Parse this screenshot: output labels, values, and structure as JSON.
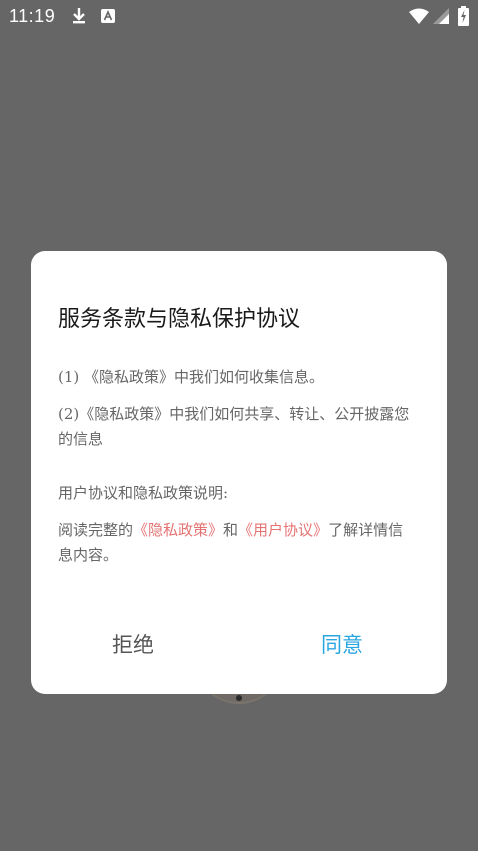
{
  "status_bar": {
    "time": "11:19",
    "icons": [
      "download-icon",
      "keyboard-a-icon",
      "wifi-icon",
      "signal-icon",
      "battery-charging-icon"
    ]
  },
  "dialog": {
    "title": "服务条款与隐私保护协议",
    "item1": "(1) 《隐私政策》中我们如何收集信息。",
    "item2": "(2)《隐私政策》中我们如何共享、转让、公开披露您的信息",
    "explain_label": "用户协议和隐私政策说明:",
    "read_prefix": "阅读完整的",
    "privacy_link": "《隐私政策》",
    "and": "和",
    "user_agreement_link": "《用户协议》",
    "read_suffix": "了解详情信息内容。",
    "refuse_label": "拒绝",
    "agree_label": "同意"
  },
  "colors": {
    "overlay": "#666666",
    "link": "#e57373",
    "agree": "#2aa6e0",
    "text": "#666666",
    "title": "#1a1a1a"
  }
}
